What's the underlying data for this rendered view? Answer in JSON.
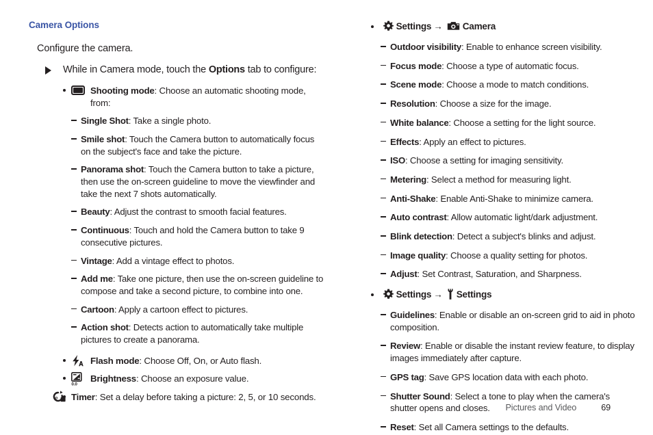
{
  "heading": "Camera Options",
  "intro": "Configure the camera.",
  "left_column": {
    "arrow_item": {
      "pre": "While in Camera mode, touch the ",
      "bold": "Options",
      "post": " tab to configure:"
    },
    "shooting_mode": {
      "icon": "shooting-mode-icon",
      "term": "Shooting mode",
      "desc": ": Choose an automatic shooting mode, from:"
    },
    "shooting_modes": [
      {
        "term": "Single Shot",
        "desc": ": Take a single photo."
      },
      {
        "term": "Smile shot",
        "desc": ": Touch the Camera button to automatically focus on the subject's face and take the picture."
      },
      {
        "term": "Panorama shot",
        "desc": ": Touch the Camera button to take a picture, then use the on-screen guideline to move the viewfinder and take the next 7 shots automatically."
      },
      {
        "term": "Beauty",
        "desc": ": Adjust the contrast to smooth facial features."
      },
      {
        "term": "Continuous",
        "desc": ": Touch and hold the Camera button to take 9 consecutive pictures."
      },
      {
        "term": "Vintage",
        "desc": ": Add a vintage effect to photos."
      },
      {
        "term": "Add me",
        "desc": ": Take one picture, then use the on-screen guideline to compose and take a second picture, to combine into one."
      },
      {
        "term": "Cartoon",
        "desc": ": Apply a cartoon effect to pictures."
      },
      {
        "term": "Action shot",
        "desc": ": Detects action to automatically take multiple pictures to create a panorama."
      }
    ],
    "icon_options": [
      {
        "icon": "flash-icon",
        "term": "Flash mode",
        "desc": ": Choose Off, On, or Auto flash."
      },
      {
        "icon": "brightness-icon",
        "term": "Brightness",
        "desc": ": Choose an exposure value."
      },
      {
        "icon": "timer-icon",
        "term": "Timer",
        "desc": ": Set a delay before taking a picture: 2, 5, or 10 seconds."
      }
    ]
  },
  "right_column": {
    "camera_group": {
      "gear_icon": "gear-icon",
      "settings_label": "Settings",
      "arrow": "→",
      "target_icon": "camera-icon",
      "target_label": "Camera",
      "items": [
        {
          "term": "Outdoor visibility",
          "desc": ": Enable to enhance screen visibility."
        },
        {
          "term": "Focus mode",
          "desc": ": Choose a type of automatic focus."
        },
        {
          "term": "Scene mode",
          "desc": ": Choose a mode to match conditions."
        },
        {
          "term": "Resolution",
          "desc": ": Choose a size for the image."
        },
        {
          "term": "White balance",
          "desc": ": Choose a setting for the light source."
        },
        {
          "term": "Effects",
          "desc": ": Apply an effect to pictures."
        },
        {
          "term": "ISO",
          "desc": ": Choose a setting for imaging sensitivity."
        },
        {
          "term": "Metering",
          "desc": ": Select a method for measuring light."
        },
        {
          "term": "Anti-Shake",
          "desc": ": Enable Anti-Shake to minimize camera."
        },
        {
          "term": "Auto contrast",
          "desc": ": Allow automatic light/dark adjustment."
        },
        {
          "term": "Blink detection",
          "desc": ": Detect a subject's blinks and adjust."
        },
        {
          "term": "Image quality",
          "desc": ": Choose a quality setting for photos."
        },
        {
          "term": "Adjust",
          "desc": ": Set Contrast, Saturation, and Sharpness."
        }
      ]
    },
    "settings_group": {
      "gear_icon": "gear-icon",
      "settings_label": "Settings",
      "arrow": "→",
      "target_icon": "wrench-icon",
      "target_label": "Settings",
      "items": [
        {
          "term": "Guidelines",
          "desc": ": Enable or disable an on-screen grid to aid in photo composition."
        },
        {
          "term": "Review",
          "desc": ": Enable or disable the instant review feature, to display images immediately after capture."
        },
        {
          "term": "GPS tag",
          "desc": ": Save GPS location data with each photo."
        },
        {
          "term": "Shutter Sound",
          "desc": ": Select a tone to play when the camera's shutter opens and closes."
        },
        {
          "term": "Reset",
          "desc": ": Set all Camera settings to the defaults."
        }
      ]
    }
  },
  "footer": {
    "chapter": "Pictures and Video",
    "page_number": "69"
  },
  "colors": {
    "heading": "#3a55a5",
    "body_text": "#231f20",
    "footer_text": "#58595b"
  }
}
